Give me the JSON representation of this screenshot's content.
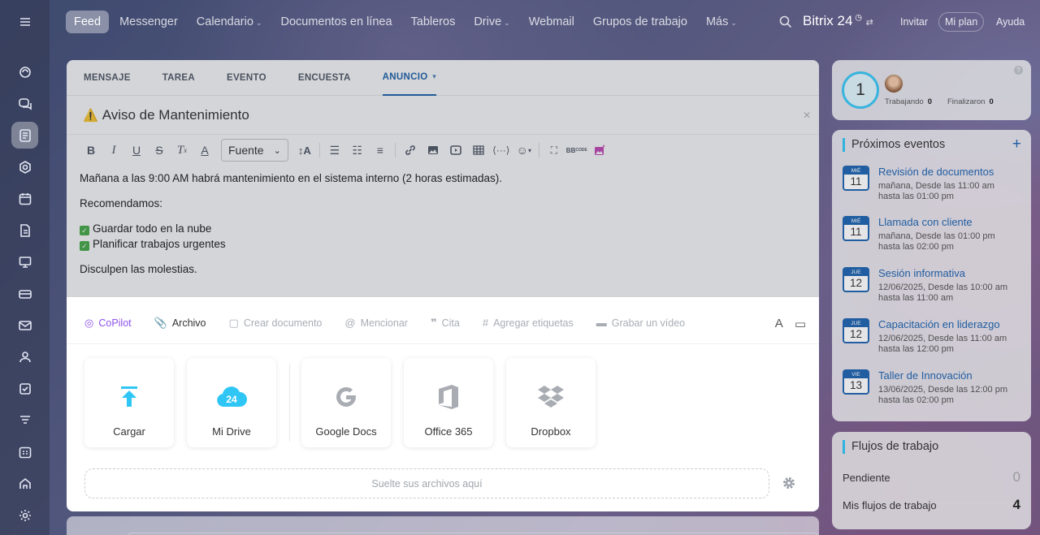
{
  "topnav": {
    "items": [
      {
        "label": "Feed",
        "active": true,
        "caret": false
      },
      {
        "label": "Messenger",
        "caret": false
      },
      {
        "label": "Calendario",
        "caret": true
      },
      {
        "label": "Documentos en línea",
        "caret": false
      },
      {
        "label": "Tableros",
        "caret": false
      },
      {
        "label": "Drive",
        "caret": true
      },
      {
        "label": "Webmail",
        "caret": false
      },
      {
        "label": "Grupos de trabajo",
        "caret": false
      },
      {
        "label": "Más",
        "caret": true
      }
    ],
    "brand": "Bitrix 24",
    "invite": "Invitar",
    "my_plan": "Mi plan",
    "help": "Ayuda"
  },
  "composer": {
    "tabs": [
      "MENSAJE",
      "TAREA",
      "EVENTO",
      "ENCUESTA",
      "ANUNCIO"
    ],
    "active_tab": "ANUNCIO",
    "title": "Aviso de Mantenimiento",
    "font_label": "Fuente",
    "body": {
      "line1": "Mañana a las 9:00 AM habrá mantenimiento en el sistema interno (2 horas estimadas).",
      "line2": "Recomendamos:",
      "check1": "Guardar todo en la nube",
      "check2": "Planificar trabajos urgentes",
      "line3": "Disculpen las molestias."
    }
  },
  "file_panel": {
    "bar": {
      "copilot": "CoPilot",
      "archivo": "Archivo",
      "crear_documento": "Crear documento",
      "mencionar": "Mencionar",
      "cita": "Cita",
      "etiquetas": "Agregar etiquetas",
      "video": "Grabar un vídeo"
    },
    "tiles": {
      "cargar": "Cargar",
      "mi_drive": "Mi Drive",
      "drive_badge": "24",
      "google_docs": "Google Docs",
      "office365": "Office 365",
      "dropbox": "Dropbox"
    },
    "dropzone": "Suelte sus archivos aquí"
  },
  "time_card": {
    "number": "1",
    "working_label": "Trabajando",
    "working_value": "0",
    "finished_label": "Finalizaron",
    "finished_value": "0"
  },
  "events": {
    "title": "Próximos eventos",
    "items": [
      {
        "month": "MIÉ",
        "day": "11",
        "title": "Revisión de documentos",
        "line1": "mañana, Desde las 11:00 am",
        "line2": "hasta las 01:00 pm"
      },
      {
        "month": "MIÉ",
        "day": "11",
        "title": "Llamada con cliente",
        "line1": "mañana, Desde las 01:00 pm",
        "line2": "hasta las 02:00 pm"
      },
      {
        "month": "JUE",
        "day": "12",
        "title": "Sesión informativa",
        "line1": "12/06/2025, Desde las 10:00 am",
        "line2": "hasta las 11:00 am"
      },
      {
        "month": "JUE",
        "day": "12",
        "title": "Capacitación en liderazgo",
        "line1": "12/06/2025, Desde las 11:00 am",
        "line2": "hasta las 12:00 pm"
      },
      {
        "month": "VIE",
        "day": "13",
        "title": "Taller de Innovación",
        "line1": "13/06/2025, Desde las 12:00 pm",
        "line2": "hasta las 02:00 pm"
      }
    ]
  },
  "workflows": {
    "title": "Flujos de trabajo",
    "pending_label": "Pendiente",
    "pending_value": "0",
    "mine_label": "Mis flujos de trabajo",
    "mine_value": "4"
  },
  "colors": {
    "accent": "#2066b0",
    "copilot": "#8e52ec",
    "upload": "#2fc6f6"
  }
}
